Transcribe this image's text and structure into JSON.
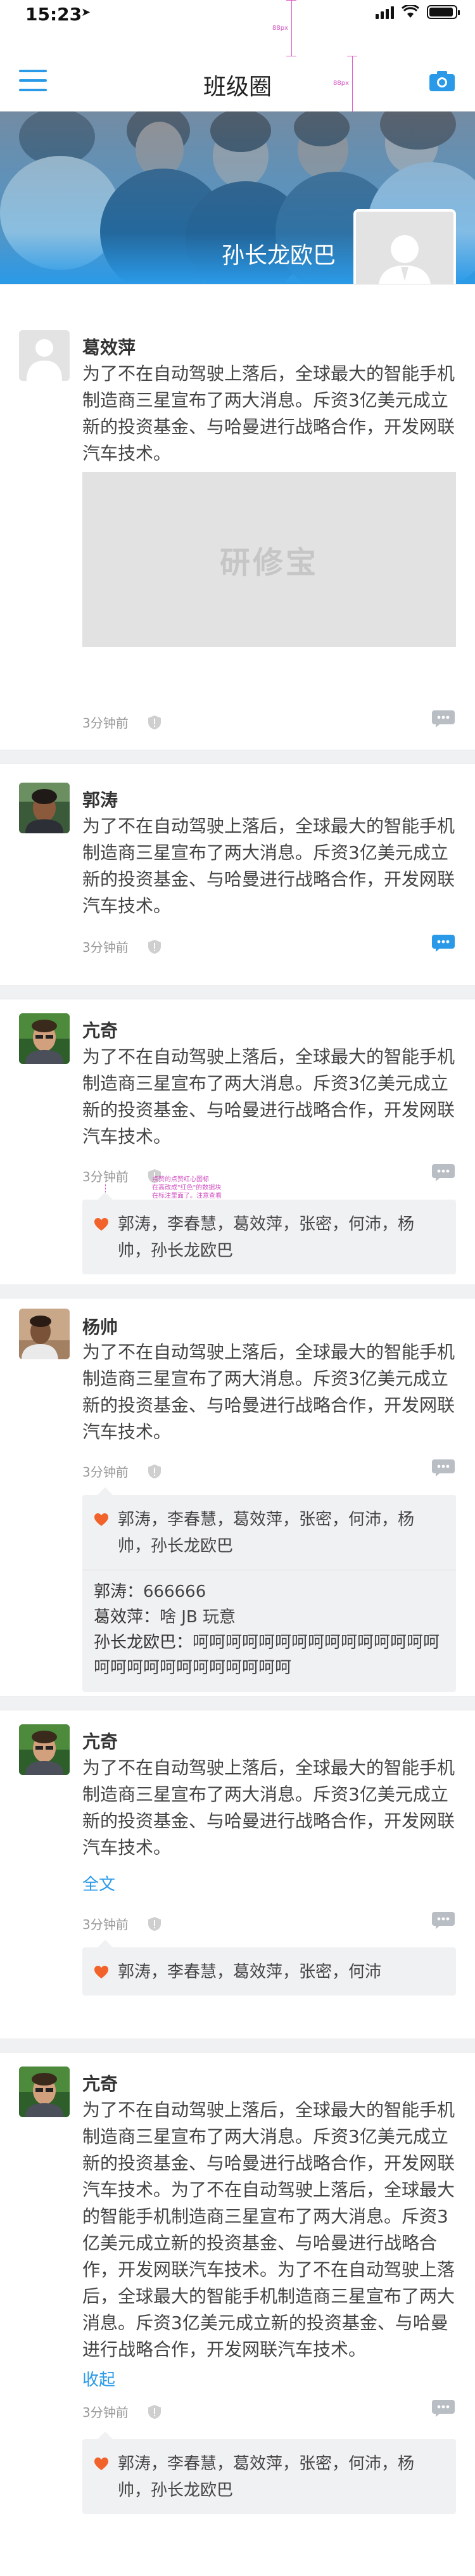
{
  "status": {
    "time": "15:23"
  },
  "nav": {
    "title": "班级圈",
    "guide_label": "88px"
  },
  "cover": {
    "name": "孙长龙欧巴"
  },
  "posts": [
    {
      "author": "葛效萍",
      "text": "为了不在自动驾驶上落后，全球最大的智能手机制造商三星宣布了两大消息。斥资3亿美元成立新的投资基金、与哈曼进行战略合作，开发网联汽车技术。",
      "image_watermark": "研修宝",
      "time": "3分钟前"
    },
    {
      "author": "郭涛",
      "text": "为了不在自动驾驶上落后，全球最大的智能手机制造商三星宣布了两大消息。斥资3亿美元成立新的投资基金、与哈曼进行战略合作，开发网联汽车技术。",
      "time": "3分钟前"
    },
    {
      "author": "亢奇",
      "text": "为了不在自动驾驶上落后，全球最大的智能手机制造商三星宣布了两大消息。斥资3亿美元成立新的投资基金、与哈曼进行战略合作，开发网联汽车技术。",
      "time": "3分钟前",
      "likes": "郭涛，李春慧，葛效萍，张密，何沛，杨帅，孙长龙欧巴",
      "annotation": "点赞的点赞红心图标\n在高改成\"红色\"的数据块\n在标注里面了。注意查看"
    },
    {
      "author": "杨帅",
      "text": "为了不在自动驾驶上落后，全球最大的智能手机制造商三星宣布了两大消息。斥资3亿美元成立新的投资基金、与哈曼进行战略合作，开发网联汽车技术。",
      "time": "3分钟前",
      "likes": "郭涛，李春慧，葛效萍，张密，何沛，杨帅，孙长龙欧巴",
      "comments": [
        {
          "name": "郭涛：",
          "text": "666666"
        },
        {
          "name": "葛效萍：",
          "text": "啥 JB 玩意"
        },
        {
          "name": "孙长龙欧巴：",
          "text": "呵呵呵呵呵呵呵呵呵呵呵呵呵呵呵呵呵呵呵呵呵呵呵呵呵呵呵"
        }
      ]
    },
    {
      "author": "亢奇",
      "text": "为了不在自动驾驶上落后，全球最大的智能手机制造商三星宣布了两大消息。斥资3亿美元成立新的投资基金、与哈曼进行战略合作，开发网联汽车技术。",
      "expand": "全文",
      "time": "3分钟前",
      "likes": "郭涛，李春慧，葛效萍，张密，何沛"
    },
    {
      "author": "亢奇",
      "text": "为了不在自动驾驶上落后，全球最大的智能手机制造商三星宣布了两大消息。斥资3亿美元成立新的投资基金、与哈曼进行战略合作，开发网联汽车技术。为了不在自动驾驶上落后，全球最大的智能手机制造商三星宣布了两大消息。斥资3亿美元成立新的投资基金、与哈曼进行战略合作，开发网联汽车技术。为了不在自动驾驶上落后，全球最大的智能手机制造商三星宣布了两大消息。斥资3亿美元成立新的投资基金、与哈曼进行战略合作，开发网联汽车技术。",
      "collapse": "收起",
      "time": "3分钟前",
      "likes": "郭涛，李春慧，葛效萍，张密，何沛，杨帅，孙长龙欧巴"
    }
  ],
  "colors": {
    "accent": "#2a9ae8",
    "heart": "#f2632b",
    "guide": "#e05cc6"
  }
}
